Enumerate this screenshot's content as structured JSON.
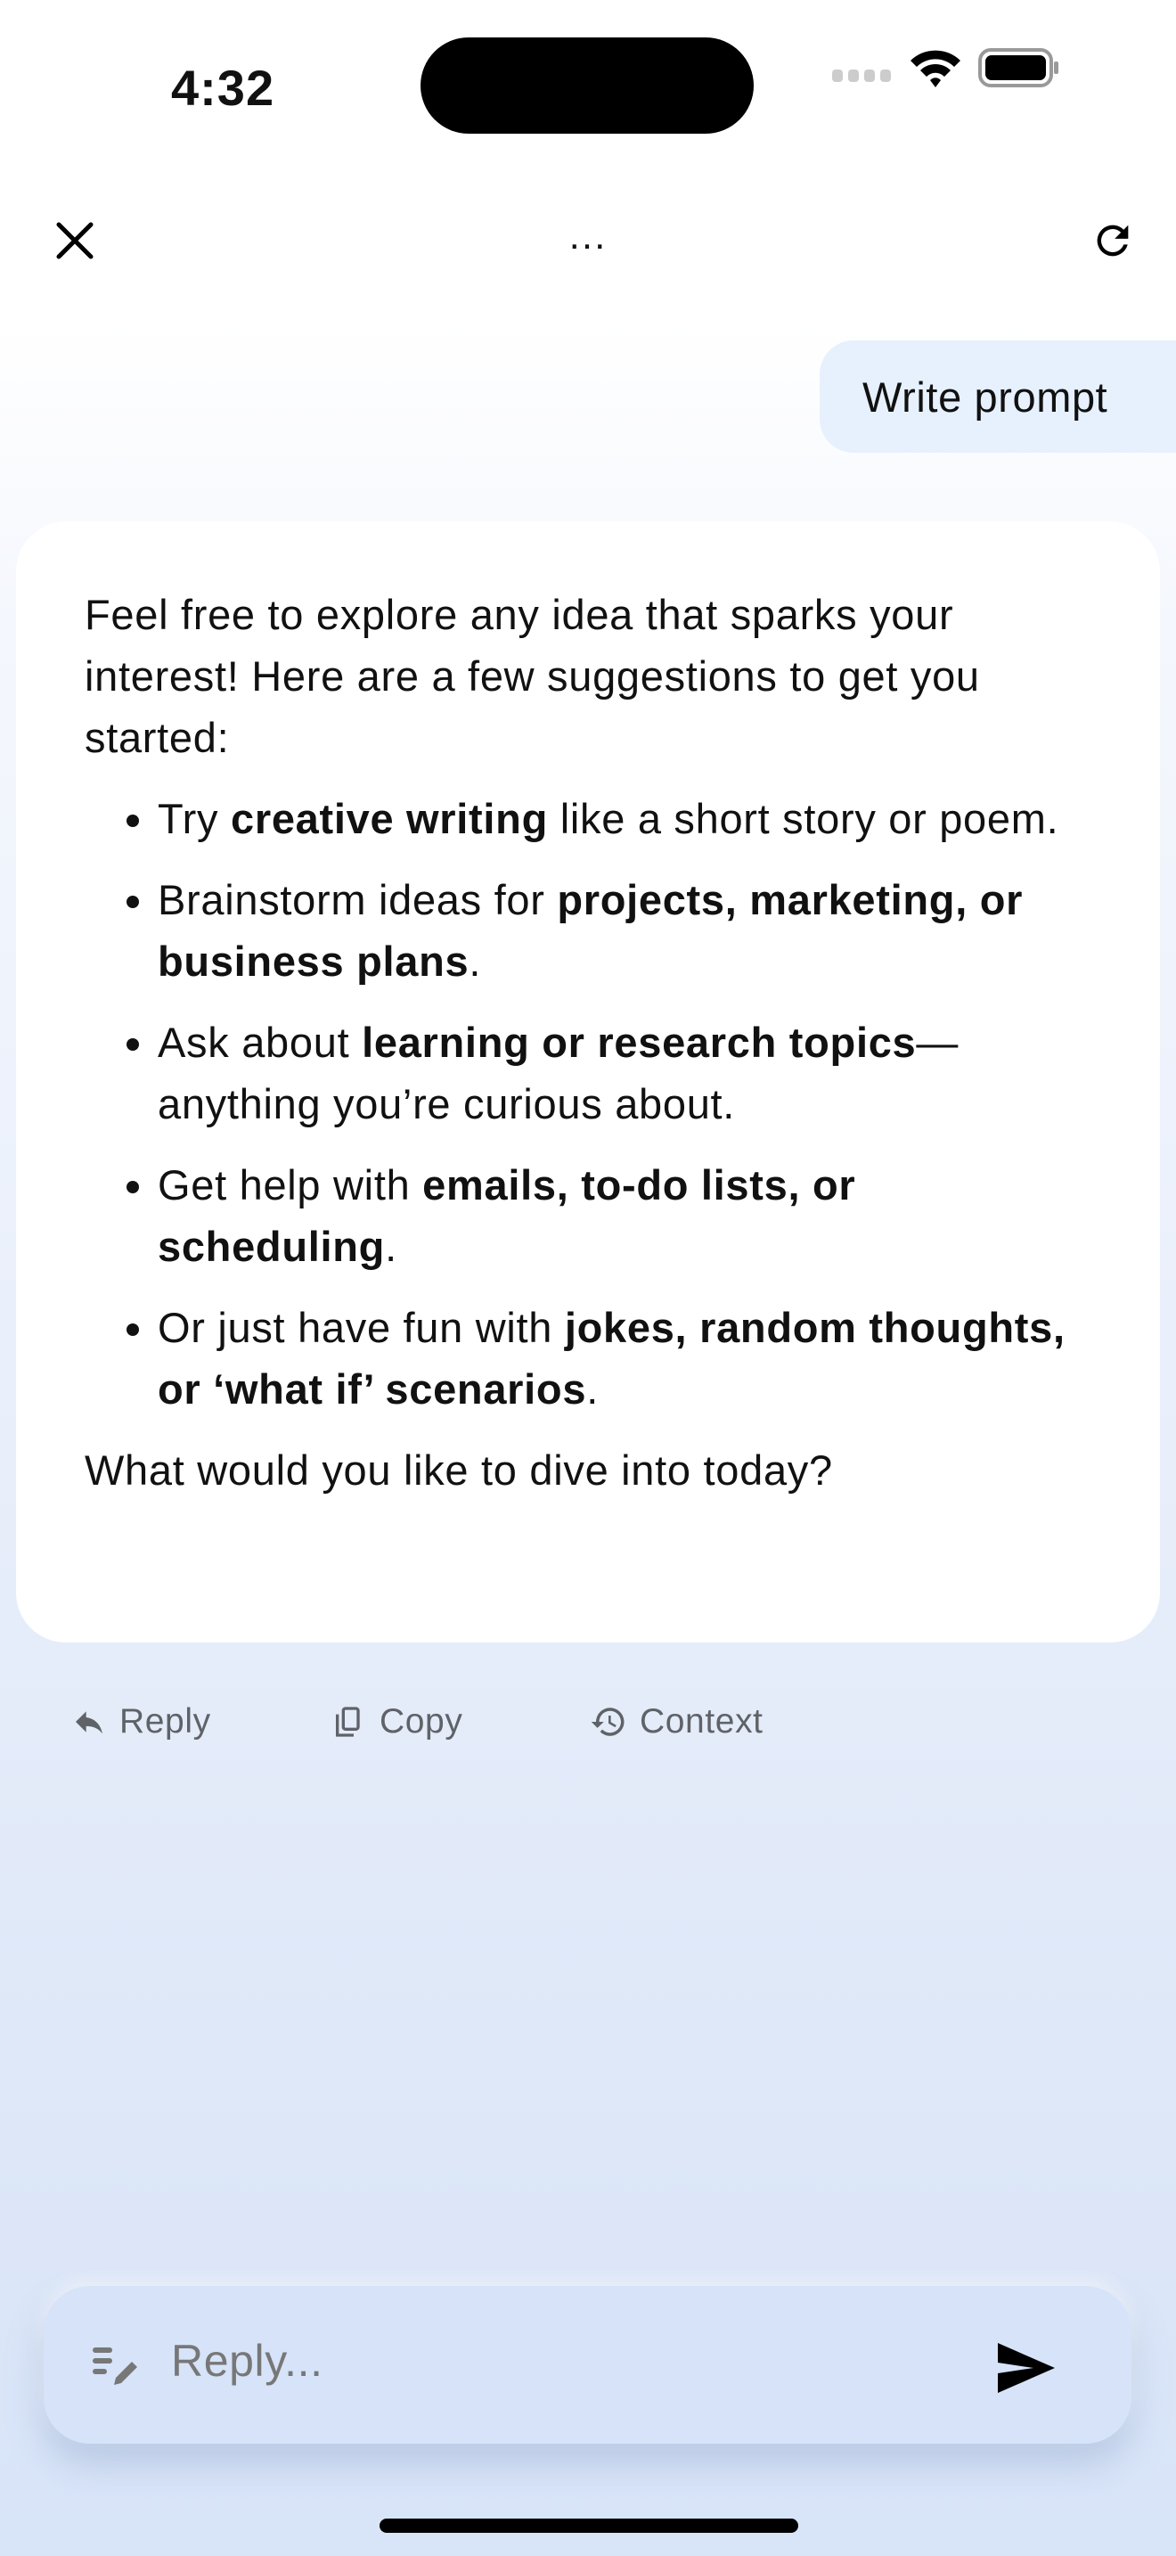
{
  "status_bar": {
    "time": "4:32"
  },
  "header": {
    "title": "...",
    "close_icon": "close-icon",
    "refresh_icon": "refresh-icon"
  },
  "user_message": {
    "text": "Write prompt"
  },
  "assistant_message": {
    "intro": "Feel free to explore any idea that sparks your interest! Here are a few suggestions to get you started:",
    "bullets": [
      {
        "pre": "Try ",
        "bold": "creative writing",
        "post": " like a short story or poem."
      },
      {
        "pre": "Brainstorm ideas for ",
        "bold": "projects, marketing, or business plans",
        "post": "."
      },
      {
        "pre": "Ask about ",
        "bold": "learning or research topics",
        "post": "—anything you’re curious about."
      },
      {
        "pre": "Get help with ",
        "bold": "emails, to-do lists, or scheduling",
        "post": "."
      },
      {
        "pre": "Or just have fun with ",
        "bold": "jokes, random thoughts, or ‘what if’ scenarios",
        "post": "."
      }
    ],
    "outro": "What would you like to dive into today?"
  },
  "actions": {
    "reply": "Reply",
    "copy": "Copy",
    "context": "Context"
  },
  "composer": {
    "placeholder": "Reply..."
  },
  "colors": {
    "user_bubble": "#e6f1fd",
    "composer_bg": "#d6e3f8",
    "action_text": "#5f6368"
  }
}
